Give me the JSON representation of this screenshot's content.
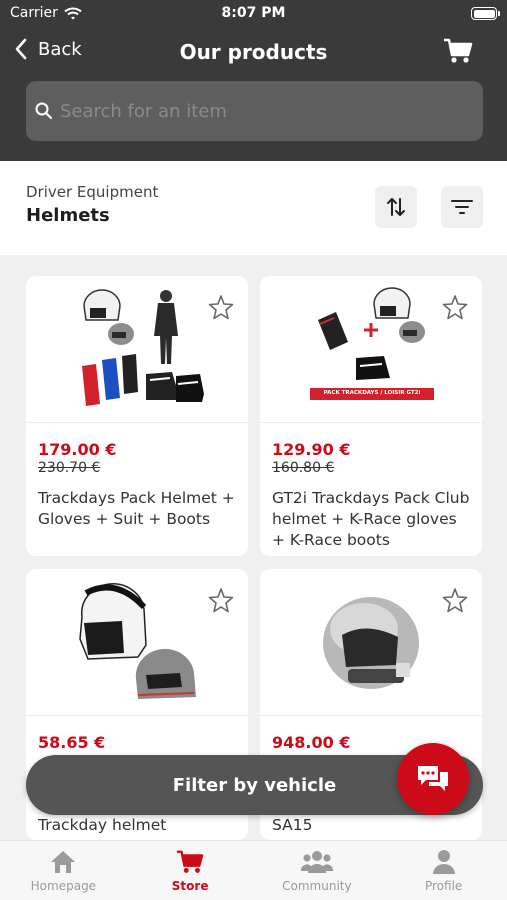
{
  "status": {
    "carrier": "Carrier",
    "time": "8:07 PM"
  },
  "nav": {
    "back_label": "Back",
    "title": "Our products"
  },
  "search": {
    "placeholder": "Search for an item"
  },
  "category": {
    "parent": "Driver Equipment",
    "title": "Helmets"
  },
  "products": [
    {
      "price": "179.00 €",
      "old_price": "230.70 €",
      "name": "Trackdays Pack Helmet + Gloves + Suit + Boots",
      "image": "helmet-gloves-suit-boots-pack"
    },
    {
      "price": "129.90 €",
      "old_price": "160.80 €",
      "name": "GT2i Trackdays Pack Club helmet + K-Race gloves + K-Race boots",
      "image": "helmet-gloves-boots-pack",
      "banner": "PACK TRACKDAYS / LOISIR GT2i"
    },
    {
      "price": "58.65 €",
      "old_price": "",
      "name": "Trackday helmet",
      "image": "open-face-helmets"
    },
    {
      "price": "948.00 €",
      "old_price": "",
      "name": "SA15",
      "image": "silver-helmet"
    }
  ],
  "filter_vehicle_label": "Filter by vehicle",
  "tabs": [
    {
      "label": "Homepage",
      "icon": "home-icon",
      "active": false
    },
    {
      "label": "Store",
      "icon": "cart-icon",
      "active": true
    },
    {
      "label": "Community",
      "icon": "people-icon",
      "active": false
    },
    {
      "label": "Profile",
      "icon": "person-icon",
      "active": false
    }
  ],
  "colors": {
    "accent": "#cc0a18",
    "header": "#3a3a3a",
    "fab": "#555555"
  }
}
